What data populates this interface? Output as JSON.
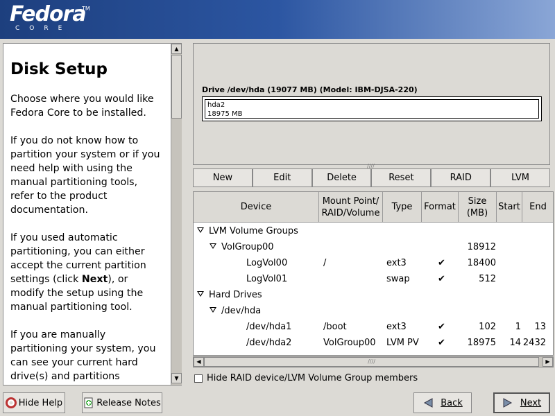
{
  "banner": {
    "logo_text": "Fedora",
    "logo_sub": "CORE",
    "logo_tm": "TM"
  },
  "help": {
    "title": "Disk Setup",
    "paragraphs": [
      "Choose where you would like Fedora Core to be installed.",
      "If you do not know how to partition your system or if you need help with using the manual partitioning tools, refer to the product documentation.",
      "If you used automatic partitioning, you can either accept the current partition settings (click Next), or modify the setup using the manual partitioning tool.",
      "If you are manually partitioning your system, you can see your current hard drive(s) and partitions displayed below. Use the partitioning tool to add, edit,"
    ]
  },
  "drive": {
    "label": "Drive /dev/hda (19077 MB) (Model: IBM-DJSA-220)",
    "partition_name": "hda2",
    "partition_size": "18975 MB"
  },
  "actions": {
    "new": "New",
    "edit": "Edit",
    "delete": "Delete",
    "reset": "Reset",
    "raid": "RAID",
    "lvm": "LVM"
  },
  "table": {
    "headers": {
      "device": "Device",
      "mount": "Mount Point/\nRAID/Volume",
      "type": "Type",
      "format": "Format",
      "size": "Size\n(MB)",
      "start": "Start",
      "end": "End"
    },
    "rows": [
      {
        "device": "LVM Volume Groups",
        "level": 0,
        "expander": true,
        "mount": "",
        "type": "",
        "format": false,
        "size": "",
        "start": "",
        "end": ""
      },
      {
        "device": "VolGroup00",
        "level": 1,
        "expander": true,
        "mount": "",
        "type": "",
        "format": false,
        "size": "18912",
        "start": "",
        "end": ""
      },
      {
        "device": "LogVol00",
        "level": 2,
        "expander": false,
        "mount": "/",
        "type": "ext3",
        "format": true,
        "size": "18400",
        "start": "",
        "end": ""
      },
      {
        "device": "LogVol01",
        "level": 2,
        "expander": false,
        "mount": "",
        "type": "swap",
        "format": true,
        "size": "512",
        "start": "",
        "end": ""
      },
      {
        "device": "Hard Drives",
        "level": 0,
        "expander": true,
        "mount": "",
        "type": "",
        "format": false,
        "size": "",
        "start": "",
        "end": ""
      },
      {
        "device": "/dev/hda",
        "level": 1,
        "expander": true,
        "mount": "",
        "type": "",
        "format": false,
        "size": "",
        "start": "",
        "end": ""
      },
      {
        "device": "/dev/hda1",
        "level": 2,
        "expander": false,
        "mount": "/boot",
        "type": "ext3",
        "format": true,
        "size": "102",
        "start": "1",
        "end": "13"
      },
      {
        "device": "/dev/hda2",
        "level": 2,
        "expander": false,
        "mount": "VolGroup00",
        "type": "LVM PV",
        "format": true,
        "size": "18975",
        "start": "14",
        "end": "2432"
      }
    ]
  },
  "hide_raid_label": "Hide RAID device/LVM Volume Group members",
  "buttons": {
    "hide_help": "Hide Help",
    "release_notes": "Release Notes",
    "back": "Back",
    "next": "Next"
  }
}
